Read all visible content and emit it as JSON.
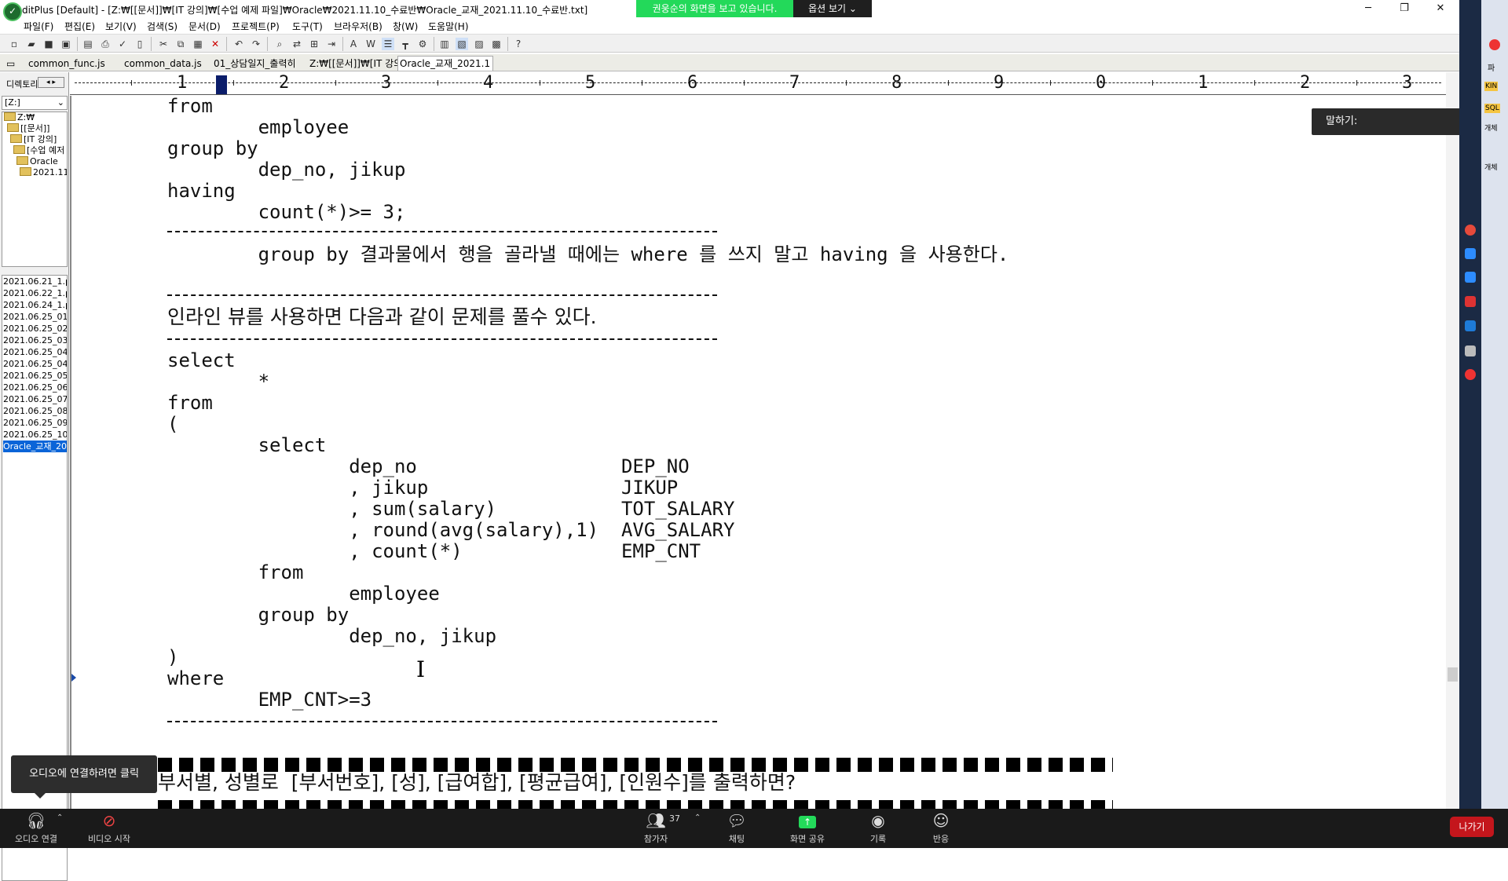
{
  "titlebar": {
    "title": "ditPlus [Default] - [Z:₩[[문서]]₩[IT 강의]₩[수업 예제 파일]₩Oracle₩2021.11.10_수료반₩Oracle_교재_2021.11.10_수료반.txt]",
    "minimize": "─",
    "restore": "❐",
    "close": "✕"
  },
  "share_banner": {
    "text": "권웅순의 화면을 보고 있습니다.",
    "options_label": "옵션 보기 ⌄"
  },
  "menu": [
    "파일(F)",
    "편집(E)",
    "보기(V)",
    "검색(S)",
    "문서(D)",
    "프로젝트(P)",
    "도구(T)",
    "브라우저(B)",
    "창(W)",
    "도움말(H)"
  ],
  "tabs": [
    "common_func.js",
    "common_data.js",
    "01_상담일지_출력히",
    "Z:₩[[문서]]₩[IT 강의",
    "Oracle_교재_2021.1"
  ],
  "left_panel": {
    "dir_label": "디렉토리",
    "drive": "[Z:]",
    "tree": [
      "Z:₩",
      "[[문서]]",
      "[IT 강의]",
      "[수업 예저",
      "Oracle",
      "2021.11"
    ],
    "files": [
      "2021.06.21_1.p",
      "2021.06.22_1.p",
      "2021.06.24_1.p",
      "2021.06.25_01",
      "2021.06.25_02",
      "2021.06.25_03",
      "2021.06.25_04",
      "2021.06.25_04",
      "2021.06.25_05",
      "2021.06.25_06",
      "2021.06.25_07",
      "2021.06.25_08",
      "2021.06.25_09",
      "2021.06.25_10",
      "Oracle_교재_20"
    ]
  },
  "ruler": {
    "numbers": [
      "1",
      "2",
      "3",
      "4",
      "5",
      "6",
      "7",
      "8",
      "9",
      "0",
      "1",
      "2",
      "3"
    ]
  },
  "editor": {
    "lines": [
      "from",
      "        employee",
      "group by",
      "        dep_no, jikup",
      "having",
      "        count(*)>= 3;",
      "        group by 결과물에서 행을 골라낼 때에는 where 를 쓰지 말고 having 을 사용한다.",
      "인라인 뷰를 사용하면 다음과 같이 문제를 풀수 있다.",
      "select",
      "        *",
      "from",
      "(",
      "        select",
      "                dep_no                  DEP_NO",
      "                , jikup                 JIKUP",
      "                , sum(salary)           TOT_SALARY",
      "                , round(avg(salary),1)  AVG_SALARY",
      "                , count(*)              EMP_CNT",
      "        from",
      "                employee",
      "        group by",
      "                dep_no, jikup",
      ")",
      "where",
      "        EMP_CNT>=3",
      "부서별, 성별로  [부서번호], [성], [급여합], [평균급여], [인원수]를 출력하면?"
    ]
  },
  "talking": "말하기:",
  "zoom": {
    "audio": "오디오 연결",
    "video": "비디오 시작",
    "participants": "참가자",
    "participants_count": "37",
    "chat": "채팅",
    "share": "화면 공유",
    "record": "기록",
    "reactions": "반응",
    "leave": "나가기",
    "audio_tip": "오디오에 연결하려면 클릭"
  },
  "right_strip": [
    "파",
    "KIN",
    "SQL",
    "개체",
    "개체"
  ]
}
